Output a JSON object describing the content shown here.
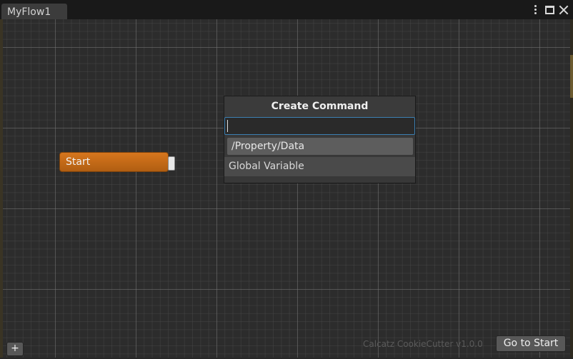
{
  "window": {
    "tab_label": "MyFlow1"
  },
  "graph": {
    "start_node": {
      "label": "Start"
    }
  },
  "create_command": {
    "title": "Create Command",
    "search_value": "",
    "results": [
      {
        "label": "/Property/Data",
        "selected": true
      },
      {
        "label": "Global Variable",
        "selected": false
      }
    ]
  },
  "footer": {
    "add_label": "+",
    "version": "Calcatz CookieCutter v1.0.0",
    "goto_start_label": "Go to Start"
  },
  "colors": {
    "start_node": "#c76a18",
    "focus_border": "#3c7fb1",
    "canvas_bg": "#2c2c2c"
  },
  "icons": [
    "more-vertical-icon",
    "maximize-icon",
    "close-icon"
  ]
}
